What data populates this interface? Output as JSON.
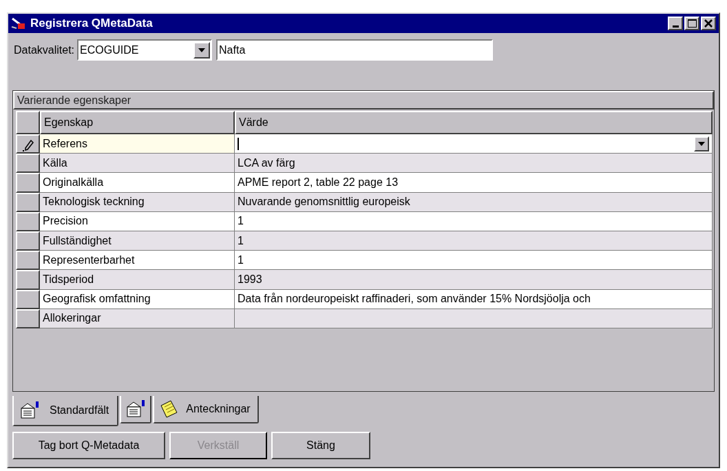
{
  "window": {
    "title": "Registrera QMetaData"
  },
  "datakvalitet": {
    "label": "Datakvalitet:",
    "value": "ECOGUIDE",
    "name": "Nafta"
  },
  "panel": {
    "title": "Varierande egenskaper"
  },
  "table": {
    "columns": [
      "Egenskap",
      "Värde"
    ],
    "rows": [
      {
        "property": "Referens",
        "value": "",
        "selected": true
      },
      {
        "property": "Källa",
        "value": "LCA av färg",
        "selected": false
      },
      {
        "property": "Originalkälla",
        "value": "APME report 2, table 22 page 13",
        "selected": false
      },
      {
        "property": "Teknologisk teckning",
        "value": "Nuvarande genomsnittlig europeisk",
        "selected": false
      },
      {
        "property": "Precision",
        "value": "1",
        "selected": false
      },
      {
        "property": "Fullständighet",
        "value": "1",
        "selected": false
      },
      {
        "property": "Representerbarhet",
        "value": "1",
        "selected": false
      },
      {
        "property": "Tidsperiod",
        "value": "1993",
        "selected": false
      },
      {
        "property": "Geografisk omfattning",
        "value": "Data från nordeuropeiskt raffinaderi, som använder 15% Nordsjöolja och",
        "selected": false
      },
      {
        "property": "Allokeringar",
        "value": "",
        "selected": false
      }
    ]
  },
  "tabs": [
    {
      "label": "Standardfält",
      "kind": "form",
      "selected": true
    },
    {
      "kind": "form",
      "selected": false
    },
    {
      "label": "Anteckningar",
      "kind": "note",
      "selected": false
    }
  ],
  "buttons": [
    {
      "label": "Tag bort Q-Metadata",
      "disabled": false
    },
    {
      "label": "Verkställ",
      "disabled": true
    },
    {
      "label": "Stäng",
      "disabled": false
    }
  ]
}
